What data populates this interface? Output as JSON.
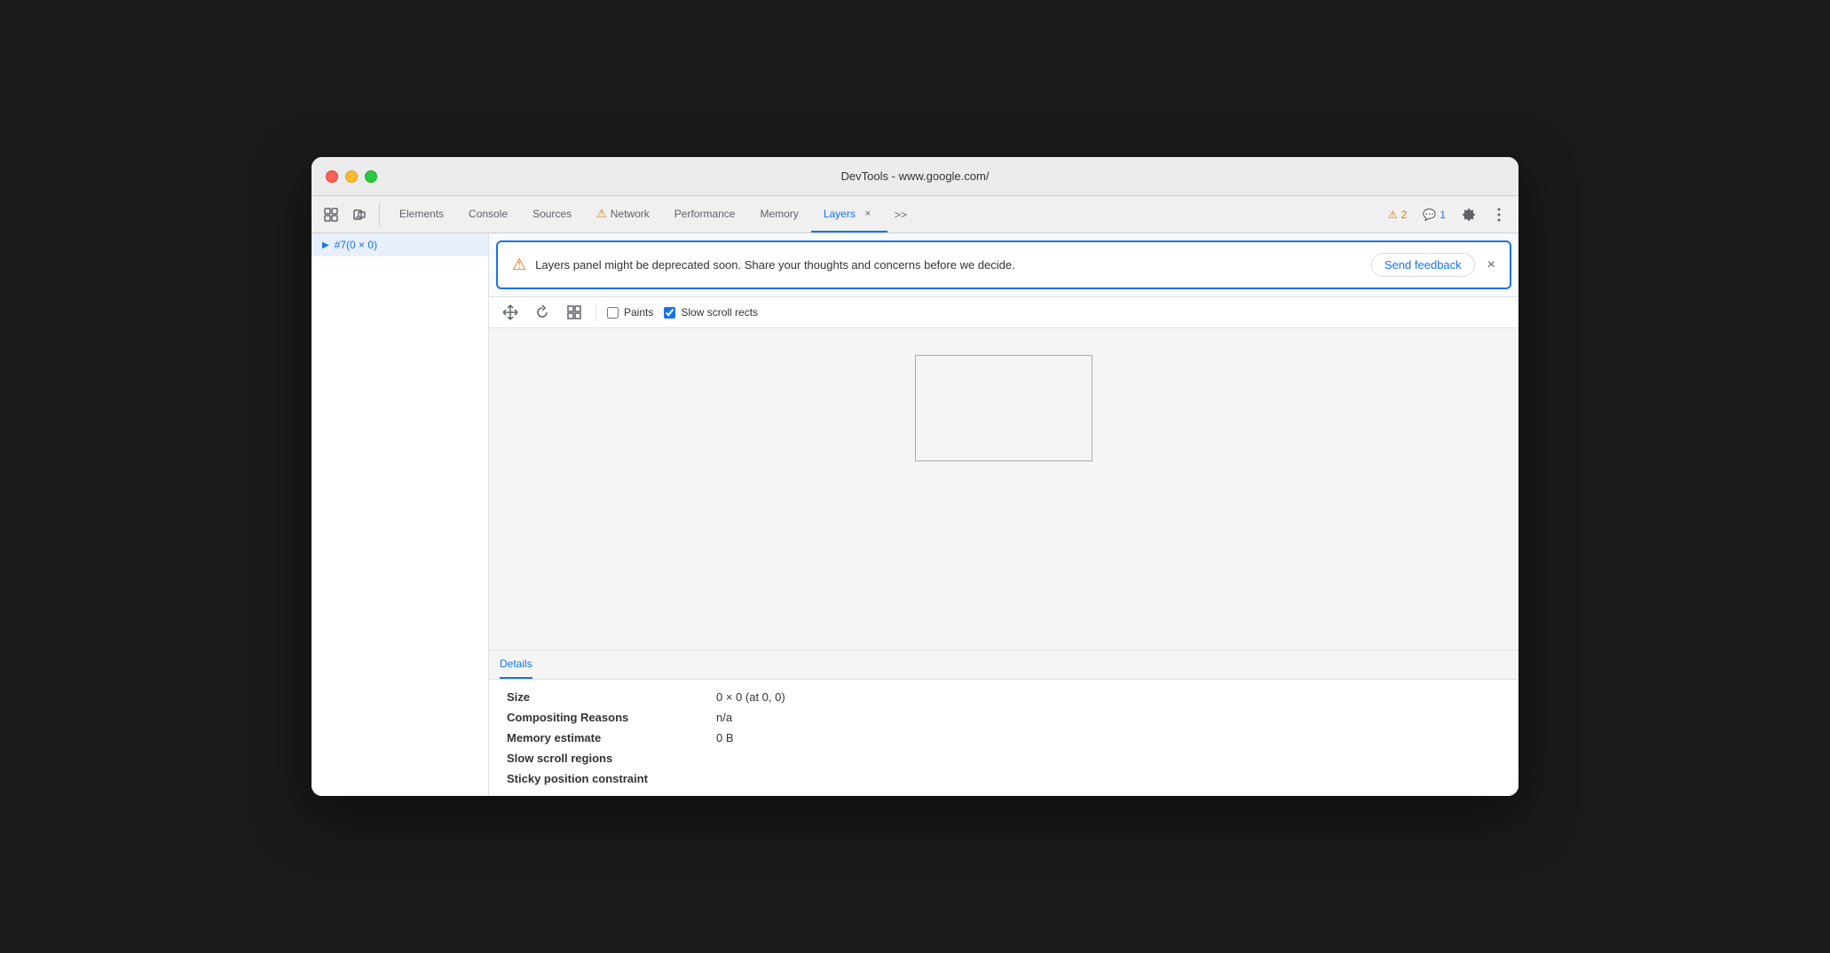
{
  "window": {
    "title": "DevTools - www.google.com/"
  },
  "toolbar": {
    "inspect_icon": "⠿",
    "device_icon": "▣",
    "tabs": [
      {
        "id": "elements",
        "label": "Elements",
        "active": false,
        "warning": false
      },
      {
        "id": "console",
        "label": "Console",
        "active": false,
        "warning": false
      },
      {
        "id": "sources",
        "label": "Sources",
        "active": false,
        "warning": false
      },
      {
        "id": "network",
        "label": "Network",
        "active": false,
        "warning": true
      },
      {
        "id": "performance",
        "label": "Performance",
        "active": false,
        "warning": false
      },
      {
        "id": "memory",
        "label": "Memory",
        "active": false,
        "warning": false
      },
      {
        "id": "layers",
        "label": "Layers",
        "active": true,
        "warning": false
      }
    ],
    "more_tabs": ">>",
    "warning_count": "2",
    "info_count": "1"
  },
  "banner": {
    "message": "Layers panel might be deprecated soon. Share your thoughts and concerns before we decide.",
    "feedback_label": "Send feedback",
    "close_label": "×"
  },
  "controls": {
    "paints_label": "Paints",
    "slow_scroll_label": "Slow scroll rects",
    "slow_scroll_checked": true,
    "paints_checked": false
  },
  "sidebar": {
    "items": [
      {
        "label": "#7(0 × 0)",
        "selected": true
      }
    ]
  },
  "details": {
    "tab_label": "Details",
    "fields": [
      {
        "label": "Size",
        "value": "0 × 0 (at 0, 0)"
      },
      {
        "label": "Compositing Reasons",
        "value": "n/a"
      },
      {
        "label": "Memory estimate",
        "value": "0 B"
      },
      {
        "label": "Slow scroll regions",
        "value": ""
      },
      {
        "label": "Sticky position constraint",
        "value": ""
      }
    ]
  }
}
